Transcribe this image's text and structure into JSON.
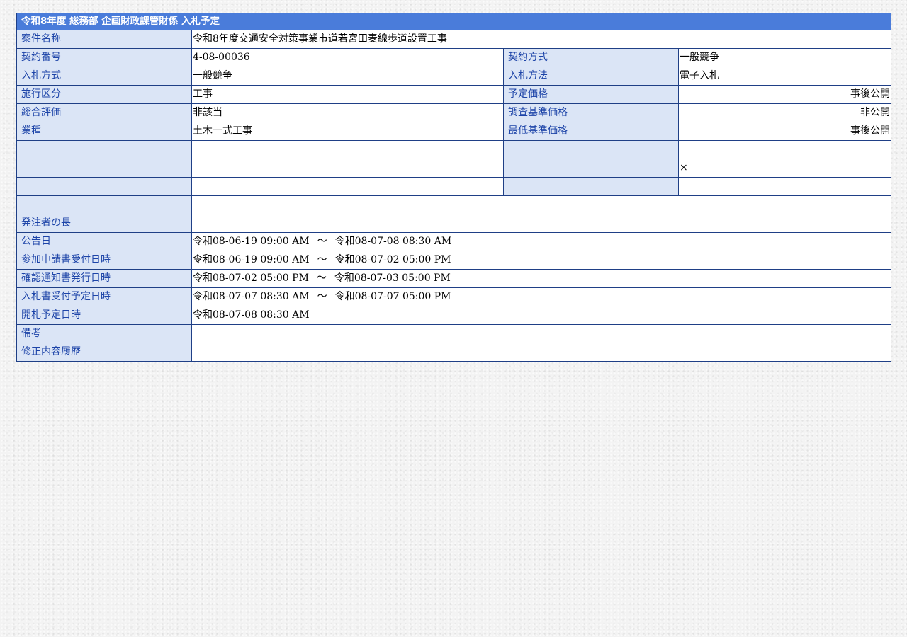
{
  "title": "令和8年度  総務部  企画財政課管財係  入札予定",
  "case_name": {
    "label": "案件名称",
    "value": "令和8年度交通安全対策事業市道若宮田麦線歩道設置工事"
  },
  "rows": [
    {
      "l1": "契約番号",
      "v1": "4-08-00036",
      "l2": "契約方式",
      "v2": "一般競争"
    },
    {
      "l1": "入札方式",
      "v1": "一般競争",
      "l2": "入札方法",
      "v2": "電子入札"
    },
    {
      "l1": "施行区分",
      "v1": "工事",
      "l2": "予定価格",
      "v2": "事後公開"
    },
    {
      "l1": "総合評価",
      "v1": "非該当",
      "l2": "調査基準価格",
      "v2": "非公開"
    },
    {
      "l1": "業種",
      "v1": "土木一式工事",
      "l2": "最低基準価格",
      "v2": "事後公開"
    },
    {
      "l1": "",
      "v1": "",
      "l2": "",
      "v2": ""
    },
    {
      "l1": "",
      "v1": "",
      "l2": "",
      "v2": "×"
    },
    {
      "l1": "",
      "v1": "",
      "l2": "",
      "v2": ""
    }
  ],
  "blank_row": {
    "label": "",
    "value": ""
  },
  "orderer": {
    "label": "発注者の長",
    "value": ""
  },
  "tilde": "～",
  "schedule": [
    {
      "label": "公告日",
      "start": "令和08-06-19 09:00 AM",
      "end": "令和08-07-08 08:30 AM"
    },
    {
      "label": "参加申請書受付日時",
      "start": "令和08-06-19 09:00 AM",
      "end": "令和08-07-02 05:00 PM"
    },
    {
      "label": "確認通知書発行日時",
      "start": "令和08-07-02 05:00 PM",
      "end": "令和08-07-03 05:00 PM"
    },
    {
      "label": "入札書受付予定日時",
      "start": "令和08-07-07 08:30 AM",
      "end": "令和08-07-07 05:00 PM"
    }
  ],
  "opening": {
    "label": "開札予定日時",
    "value": "令和08-07-08 08:30 AM"
  },
  "remarks": {
    "label": "備考",
    "value": ""
  },
  "history": {
    "label": "修正内容履歴",
    "value": ""
  }
}
